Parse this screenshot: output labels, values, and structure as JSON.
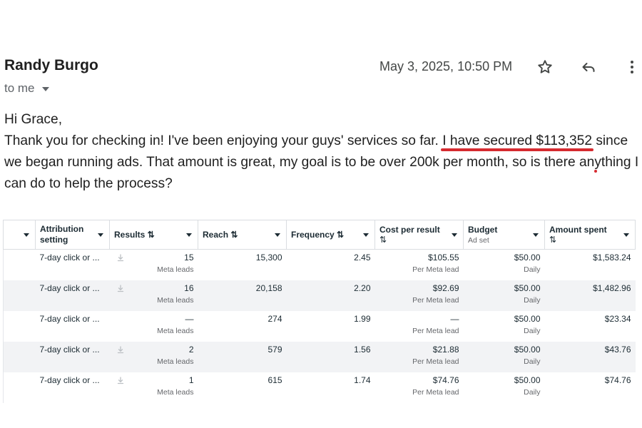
{
  "email": {
    "sender": "Randy Burgo",
    "recipient": "to me",
    "date": "May 3, 2025, 10:50 PM",
    "greeting": "Hi Grace,",
    "body_part1": "Thank you for checking in! I've been enjoying your guys' services so far. ",
    "highlight1": "I have secured $113,352",
    "highlight2": "since we began running ads.",
    "body_part2": " That amount is great, my goal is to be over 200k per month, so is there anything I can do to help the process?"
  },
  "icons": {
    "star": "star-icon",
    "reply": "reply-icon",
    "more": "more-vert-icon",
    "download": "download-icon"
  },
  "colors": {
    "highlight_underline": "#d62b30",
    "row_alt": "#f2f3f5"
  },
  "table": {
    "headers": {
      "attribution": "Attribution setting",
      "results": "Results ⇅",
      "reach": "Reach ⇅",
      "frequency": "Frequency ⇅",
      "cost": "Cost per result",
      "cost_sort": "⇅",
      "budget": "Budget",
      "budget_sub": "Ad set",
      "amount": "Amount spent",
      "amount_sort": "⇅"
    },
    "rows": [
      {
        "attribution": "7-day click or ...",
        "results": "15",
        "results_sub": "Meta leads",
        "reach": "15,300",
        "frequency": "2.45",
        "cost": "$105.55",
        "cost_sub": "Per Meta lead",
        "budget": "$50.00",
        "budget_sub": "Daily",
        "amount": "$1,583.24"
      },
      {
        "attribution": "7-day click or ...",
        "results": "16",
        "results_sub": "Meta leads",
        "reach": "20,158",
        "frequency": "2.20",
        "cost": "$92.69",
        "cost_sub": "Per Meta lead",
        "budget": "$50.00",
        "budget_sub": "Daily",
        "amount": "$1,482.96"
      },
      {
        "attribution": "7-day click or ...",
        "results": "—",
        "results_sub": "Meta leads",
        "reach": "274",
        "frequency": "1.99",
        "cost": "—",
        "cost_sub": "Per Meta lead",
        "budget": "$50.00",
        "budget_sub": "Daily",
        "amount": "$23.34"
      },
      {
        "attribution": "7-day click or ...",
        "results": "2",
        "results_sub": "Meta leads",
        "reach": "579",
        "frequency": "1.56",
        "cost": "$21.88",
        "cost_sub": "Per Meta lead",
        "budget": "$50.00",
        "budget_sub": "Daily",
        "amount": "$43.76"
      },
      {
        "attribution": "7-day click or ...",
        "results": "1",
        "results_sub": "Meta leads",
        "reach": "615",
        "frequency": "1.74",
        "cost": "$74.76",
        "cost_sub": "Per Meta lead",
        "budget": "$50.00",
        "budget_sub": "Daily",
        "amount": "$74.76"
      }
    ]
  }
}
